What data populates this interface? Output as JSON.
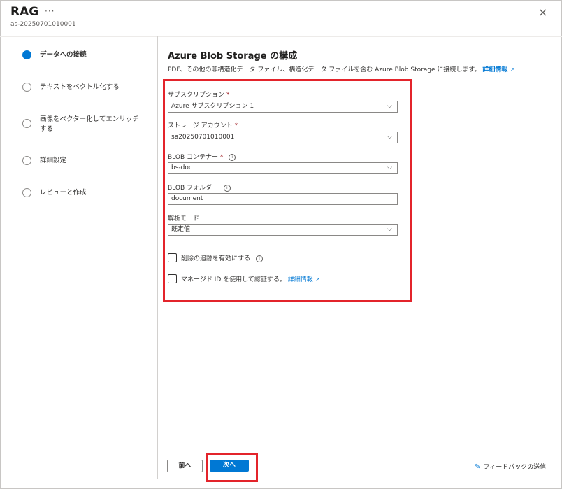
{
  "header": {
    "title": "RAG",
    "more": "···",
    "subtitle": "as-20250701010001",
    "close": "×"
  },
  "steps": [
    {
      "label": "データへの接続",
      "active": true
    },
    {
      "label": "テキストをベクトル化する",
      "active": false
    },
    {
      "label": "画像をベクター化してエンリッチする",
      "active": false
    },
    {
      "label": "詳細設定",
      "active": false
    },
    {
      "label": "レビューと作成",
      "active": false
    }
  ],
  "main": {
    "title": "Azure Blob Storage の構成",
    "description": "PDF、その他の非構造化データ ファイル、構造化データ ファイルを含む Azure Blob Storage に接続します。",
    "learn_more": "詳細情報",
    "subscription": {
      "label": "サブスクリプション",
      "required_mark": "*",
      "value": "Azure サブスクリプション 1"
    },
    "storage_account": {
      "label": "ストレージ アカウント",
      "required_mark": "*",
      "value": "sa20250701010001"
    },
    "blob_container": {
      "label": "BLOB コンテナー",
      "required_mark": "*",
      "value": "bs-doc"
    },
    "blob_folder": {
      "label": "BLOB フォルダー",
      "value": "document"
    },
    "parse_mode": {
      "label": "解析モード",
      "value": "既定値"
    },
    "deletion_tracking": {
      "label": "削除の追跡を有効にする",
      "checked": false
    },
    "managed_identity": {
      "label": "マネージド ID を使用して認証する。",
      "learn_more": "詳細情報",
      "checked": false
    }
  },
  "footer": {
    "prev_label": "前へ",
    "next_label": "次へ",
    "feedback_label": "フィードバックの送信"
  },
  "colors": {
    "accent": "#0078d4",
    "highlight": "#e3242b"
  }
}
